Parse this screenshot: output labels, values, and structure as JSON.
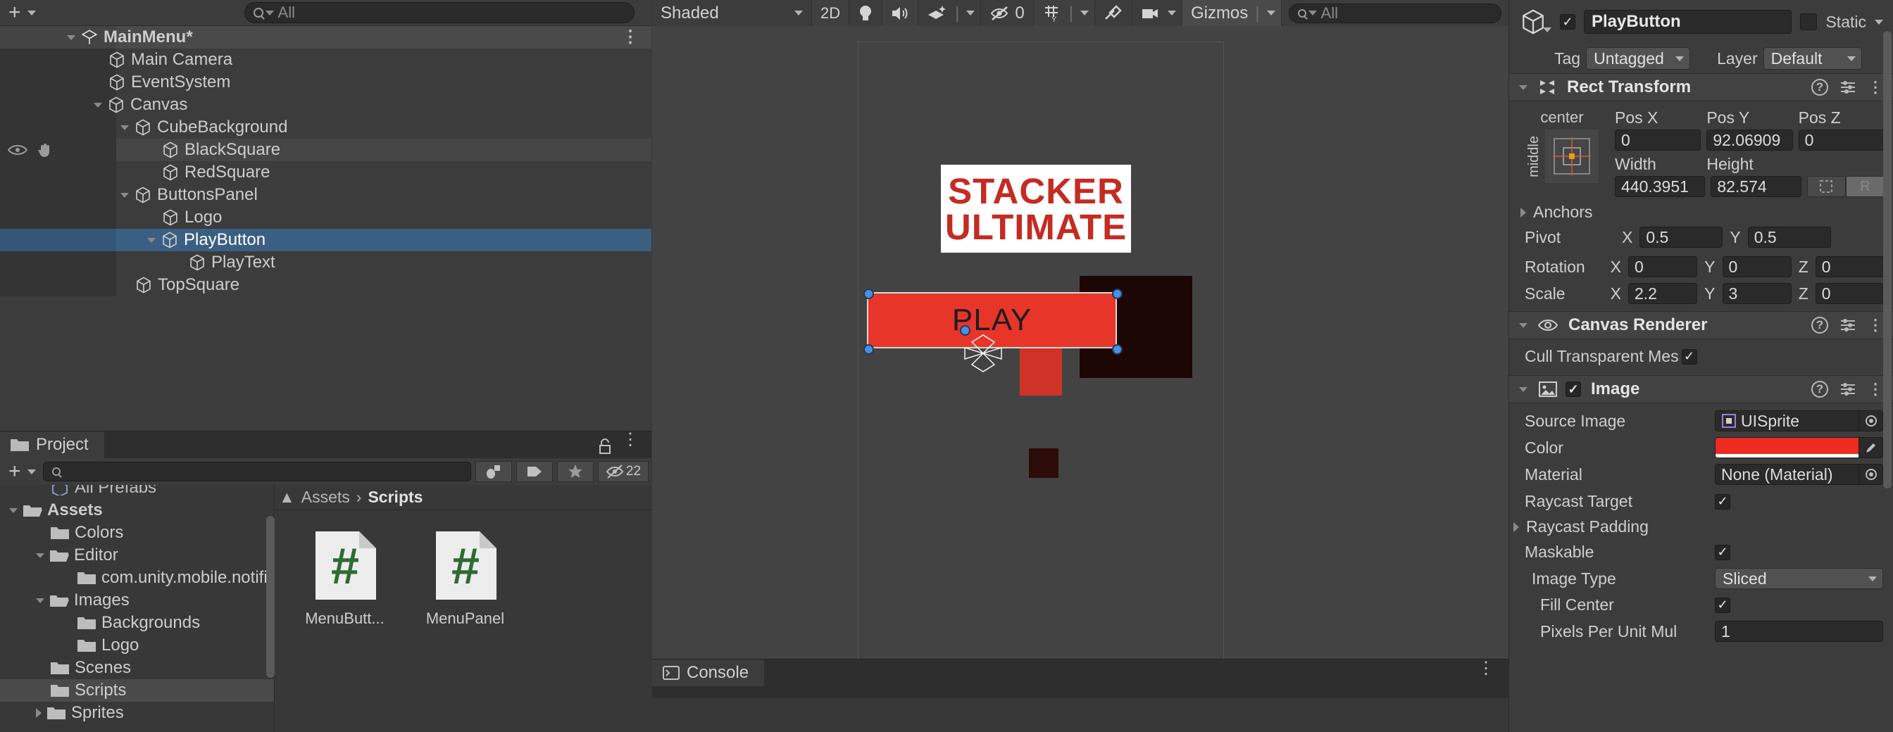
{
  "hierarchy": {
    "search_placeholder": "All",
    "add_button": "+",
    "scene_name": "MainMenu*",
    "items": [
      {
        "label": "MainMenu*",
        "depth": 0,
        "arrow": "down",
        "icon": "unity-scene-icon",
        "state": "scene"
      },
      {
        "label": "Main Camera",
        "depth": 1,
        "arrow": "none",
        "icon": "gameobject-cube-icon",
        "state": "normal"
      },
      {
        "label": "EventSystem",
        "depth": 1,
        "arrow": "none",
        "icon": "gameobject-cube-icon",
        "state": "normal"
      },
      {
        "label": "Canvas",
        "depth": 1,
        "arrow": "down",
        "icon": "gameobject-cube-icon",
        "state": "normal"
      },
      {
        "label": "CubeBackground",
        "depth": 2,
        "arrow": "down",
        "icon": "gameobject-cube-icon",
        "state": "normal"
      },
      {
        "label": "BlackSquare",
        "depth": 3,
        "arrow": "none",
        "icon": "gameobject-cube-icon",
        "state": "hover"
      },
      {
        "label": "RedSquare",
        "depth": 3,
        "arrow": "none",
        "icon": "gameobject-cube-icon",
        "state": "normal"
      },
      {
        "label": "ButtonsPanel",
        "depth": 2,
        "arrow": "down",
        "icon": "gameobject-cube-icon",
        "state": "normal"
      },
      {
        "label": "Logo",
        "depth": 3,
        "arrow": "none",
        "icon": "gameobject-cube-icon",
        "state": "normal"
      },
      {
        "label": "PlayButton",
        "depth": 3,
        "arrow": "down",
        "icon": "gameobject-cube-icon",
        "state": "selected"
      },
      {
        "label": "PlayText",
        "depth": 4,
        "arrow": "none",
        "icon": "gameobject-cube-icon",
        "state": "normal"
      },
      {
        "label": "TopSquare",
        "depth": 2,
        "arrow": "none",
        "icon": "gameobject-cube-icon",
        "state": "normal"
      }
    ]
  },
  "project": {
    "tab_label": "Project",
    "search_placeholder": "",
    "hidden_count": "22",
    "breadcrumb": {
      "root": "Assets",
      "current": "Scripts",
      "separator": "›"
    },
    "tree": [
      {
        "label": "All Prefabs",
        "depth": 1,
        "arrow": "none",
        "icon": "prefab-icon",
        "state": "clipped"
      },
      {
        "label": "Assets",
        "depth": 0,
        "arrow": "down",
        "icon": "folder-open-icon",
        "state": "top"
      },
      {
        "label": "Colors",
        "depth": 1,
        "arrow": "none",
        "icon": "folder-icon",
        "state": "normal"
      },
      {
        "label": "Editor",
        "depth": 1,
        "arrow": "down",
        "icon": "folder-open-icon",
        "state": "normal"
      },
      {
        "label": "com.unity.mobile.notifi",
        "depth": 2,
        "arrow": "none",
        "icon": "folder-icon",
        "state": "normal"
      },
      {
        "label": "Images",
        "depth": 1,
        "arrow": "down",
        "icon": "folder-open-icon",
        "state": "normal"
      },
      {
        "label": "Backgrounds",
        "depth": 2,
        "arrow": "none",
        "icon": "folder-icon",
        "state": "normal"
      },
      {
        "label": "Logo",
        "depth": 2,
        "arrow": "none",
        "icon": "folder-icon",
        "state": "normal"
      },
      {
        "label": "Scenes",
        "depth": 1,
        "arrow": "none",
        "icon": "folder-icon",
        "state": "normal"
      },
      {
        "label": "Scripts",
        "depth": 1,
        "arrow": "none",
        "icon": "folder-icon",
        "state": "selected"
      },
      {
        "label": "Sprites",
        "depth": 1,
        "arrow": "right",
        "icon": "folder-icon",
        "state": "normal"
      }
    ],
    "assets": [
      {
        "label": "MenuButt...",
        "icon": "csharp-script-icon"
      },
      {
        "label": "MenuPanel",
        "icon": "csharp-script-icon"
      }
    ]
  },
  "scene": {
    "toolbar": {
      "draw_mode": "Shaded",
      "two_d": "2D",
      "lighting_icon": "lightbulb-icon",
      "audio_icon": "speaker-icon",
      "fx_icon": "effects-icon",
      "hidden_objects": "0",
      "grid_icon": "grid-icon",
      "tools_icon": "tools-icon",
      "camera_icon": "scene-camera-icon",
      "gizmos": "Gizmos",
      "search_placeholder": "All"
    },
    "logo": {
      "line1": "STACKER",
      "line2": "ULTIMATE"
    },
    "play_button_label": "PLAY",
    "console_tab": "Console"
  },
  "inspector": {
    "object_name": "PlayButton",
    "enabled": true,
    "static_label": "Static",
    "tag_label": "Tag",
    "tag_value": "Untagged",
    "layer_label": "Layer",
    "layer_value": "Default",
    "rect_transform": {
      "title": "Rect Transform",
      "anchor_preset_top": "center",
      "anchor_preset_side": "middle",
      "labels": {
        "pos_x": "Pos X",
        "pos_y": "Pos Y",
        "pos_z": "Pos Z",
        "width": "Width",
        "height": "Height",
        "anchors": "Anchors",
        "pivot": "Pivot",
        "rotation": "Rotation",
        "scale": "Scale"
      },
      "pos_x": "0",
      "pos_y": "92.06909",
      "pos_z": "0",
      "width": "440.3951",
      "height": "82.574",
      "blueprint_icon": "blueprint-mode-icon",
      "raw_icon": "R",
      "pivot_x": "0.5",
      "pivot_y": "0.5",
      "rotation_x": "0",
      "rotation_y": "0",
      "rotation_z": "0",
      "scale_x": "2.2",
      "scale_y": "3",
      "scale_z": "0",
      "axis_x": "X",
      "axis_y": "Y",
      "axis_z": "Z"
    },
    "canvas_renderer": {
      "title": "Canvas Renderer",
      "cull_label": "Cull Transparent Mes",
      "cull_checked": true
    },
    "image": {
      "title": "Image",
      "enabled": true,
      "source_image_label": "Source Image",
      "source_image_value": "UISprite",
      "color_label": "Color",
      "color_value": "#ED2B1F",
      "material_label": "Material",
      "material_value": "None (Material)",
      "raycast_target_label": "Raycast Target",
      "raycast_target_checked": true,
      "raycast_padding_label": "Raycast Padding",
      "maskable_label": "Maskable",
      "maskable_checked": true,
      "image_type_label": "Image Type",
      "image_type_value": "Sliced",
      "fill_center_label": "Fill Center",
      "fill_center_checked": true,
      "pixels_per_unit_label": "Pixels Per Unit Mul",
      "pixels_per_unit_value": "1"
    }
  },
  "colors": {
    "selection_blue": "#3b5f82",
    "play_red": "#e8352a",
    "logo_red": "#c42b22",
    "panel_bg": "#3c3c3c"
  }
}
